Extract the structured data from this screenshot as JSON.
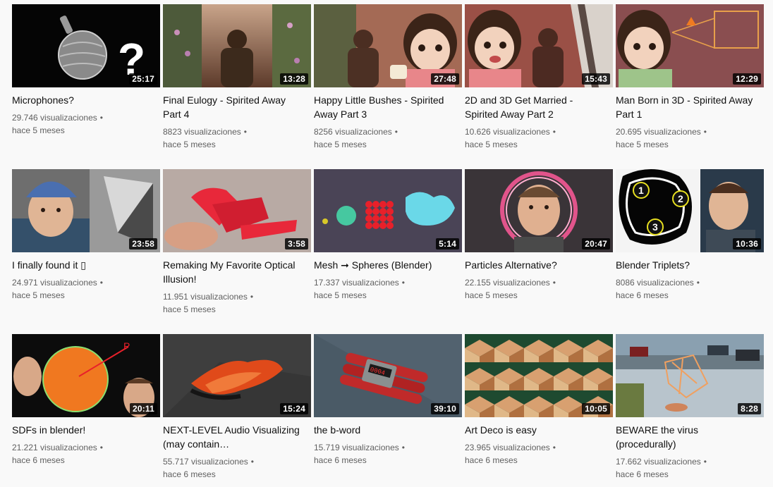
{
  "videos": [
    {
      "title": "Microphones?",
      "views": "29.746 visualizaciones",
      "age": "hace 5 meses",
      "duration": "25:17",
      "thumb_icon": "microphone-icon"
    },
    {
      "title": "Final Eulogy - Spirited Away Part 4",
      "views": "8823 visualizaciones",
      "age": "hace 5 meses",
      "duration": "13:28",
      "thumb_icon": "garden-path-icon"
    },
    {
      "title": "Happy Little Bushes - Spirited Away Part 3",
      "views": "8256 visualizaciones",
      "age": "hace 5 meses",
      "duration": "27:48",
      "thumb_icon": "anime-girl-icon"
    },
    {
      "title": "2D and 3D Get Married - Spirited Away Part 2",
      "views": "10.626 visualizaciones",
      "age": "hace 5 meses",
      "duration": "15:43",
      "thumb_icon": "anime-girl-icon"
    },
    {
      "title": "Man Born in 3D - Spirited Away Part 1",
      "views": "20.695 visualizaciones",
      "age": "hace 5 meses",
      "duration": "12:29",
      "thumb_icon": "anime-girl-icon"
    },
    {
      "title": "I finally found it ▯",
      "views": "24.971 visualizaciones",
      "age": "hace 5 meses",
      "duration": "23:58",
      "thumb_icon": "person-icon"
    },
    {
      "title": "Remaking My Favorite Optical Illusion!",
      "views": "11.951 visualizaciones",
      "age": "hace 5 meses",
      "duration": "3:58",
      "thumb_icon": "optical-illusion-icon"
    },
    {
      "title": "Mesh ➞ Spheres (Blender)",
      "views": "17.337 visualizaciones",
      "age": "hace 5 meses",
      "duration": "5:14",
      "thumb_icon": "spheres-icon"
    },
    {
      "title": "Particles Alternative?",
      "views": "22.155 visualizaciones",
      "age": "hace 5 meses",
      "duration": "20:47",
      "thumb_icon": "person-icon"
    },
    {
      "title": "Blender Triplets?",
      "views": "8086 visualizaciones",
      "age": "hace 6 meses",
      "duration": "10:36",
      "thumb_icon": "triplet-icon"
    },
    {
      "title": "SDFs in blender!",
      "views": "21.221 visualizaciones",
      "age": "hace 6 meses",
      "duration": "20:11",
      "thumb_icon": "sphere-diagram-icon"
    },
    {
      "title": "NEXT-LEVEL Audio Visualizing (may contain…",
      "views": "55.717 visualizaciones",
      "age": "hace 6 meses",
      "duration": "15:24",
      "thumb_icon": "particles-icon"
    },
    {
      "title": "the b-word",
      "views": "15.719 visualizaciones",
      "age": "hace 6 meses",
      "duration": "39:10",
      "thumb_icon": "bomb-icon"
    },
    {
      "title": "Art Deco is easy",
      "views": "23.965 visualizaciones",
      "age": "hace 6 meses",
      "duration": "10:05",
      "thumb_icon": "pattern-icon"
    },
    {
      "title": "BEWARE the virus (procedurally)",
      "views": "17.662 visualizaciones",
      "age": "hace 6 meses",
      "duration": "8:28",
      "thumb_icon": "street-icon"
    }
  ],
  "dot": "•",
  "colors": {
    "text": "#0f0f0f",
    "meta": "#606060",
    "background": "#f9f9f9",
    "badge": "#000000"
  }
}
